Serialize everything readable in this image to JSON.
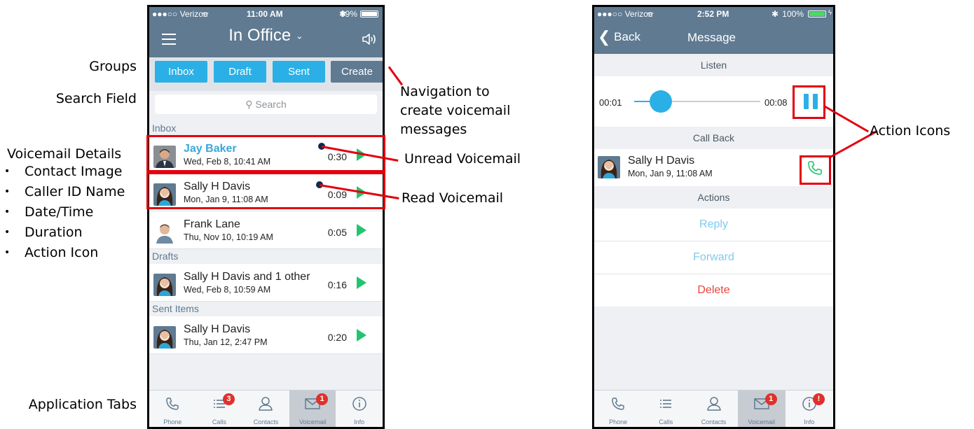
{
  "annotations": {
    "groups": "Groups",
    "search_field": "Search Field",
    "voicemail_details": "Voicemail Details",
    "details_list": [
      "Contact Image",
      "Caller ID Name",
      "Date/Time",
      "Duration",
      "Action Icon"
    ],
    "navigation": [
      "Navigation to",
      "create voicemail",
      "messages"
    ],
    "unread": "Unread Voicemail",
    "read": "Read Voicemail",
    "action_icons": "Action Icons",
    "application_tabs": "Application Tabs",
    "bullet": "•"
  },
  "left_phone": {
    "status": {
      "carrier": "●●●○○ Verizon",
      "time": "11:00 AM",
      "battery": "99%"
    },
    "title": "In Office",
    "groups": {
      "inbox": "Inbox",
      "draft": "Draft",
      "sent": "Sent",
      "create": "Create"
    },
    "search_placeholder": "Search",
    "sections": {
      "inbox": "Inbox",
      "drafts": "Drafts",
      "sent_items": "Sent Items"
    },
    "rows": [
      {
        "name": "Jay Baker",
        "date": "Wed, Feb 8, 10:41 AM",
        "duration": "0:30",
        "unread": true
      },
      {
        "name": "Sally H Davis",
        "date": "Mon, Jan 9, 11:08 AM",
        "duration": "0:09",
        "unread": false
      },
      {
        "name": "Frank Lane",
        "date": "Thu, Nov 10, 10:19 AM",
        "duration": "0:05",
        "unread": false
      },
      {
        "name": "Sally H Davis and 1 other",
        "date": "Wed, Feb 8, 10:59 AM",
        "duration": "0:16",
        "unread": false
      },
      {
        "name": "Sally H Davis",
        "date": "Thu, Jan 12, 2:47 PM",
        "duration": "0:20",
        "unread": false
      }
    ],
    "tabs": [
      {
        "label": "Phone",
        "icon": "phone-icon",
        "badge": ""
      },
      {
        "label": "Calls",
        "icon": "list-icon",
        "badge": "3"
      },
      {
        "label": "Contacts",
        "icon": "person-icon",
        "badge": ""
      },
      {
        "label": "Voicemail",
        "icon": "envelope-icon",
        "badge": "1"
      },
      {
        "label": "Info",
        "icon": "info-icon",
        "badge": ""
      }
    ]
  },
  "right_phone": {
    "status": {
      "carrier": "●●●○○ Verizon",
      "time": "2:52 PM",
      "battery": "100%"
    },
    "back": "Back",
    "title": "Message",
    "listen": "Listen",
    "time_start": "00:01",
    "time_end": "00:08",
    "playback_progress": 0.12,
    "call_back": "Call Back",
    "contact_name": "Sally H Davis",
    "contact_date": "Mon, Jan 9, 11:08 AM",
    "actions": "Actions",
    "reply": "Reply",
    "forward": "Forward",
    "delete": "Delete",
    "tabs": [
      {
        "label": "Phone",
        "icon": "phone-icon",
        "badge": ""
      },
      {
        "label": "Calls",
        "icon": "list-icon",
        "badge": ""
      },
      {
        "label": "Contacts",
        "icon": "person-icon",
        "badge": ""
      },
      {
        "label": "Voicemail",
        "icon": "envelope-icon",
        "badge": "1"
      },
      {
        "label": "Info",
        "icon": "info-icon",
        "badge": "!"
      }
    ]
  },
  "colors": {
    "nav": "#5f7a91",
    "accent": "#3aa6dc",
    "play": "#21c56f",
    "delete": "#e8453c",
    "highlight": "#e3000f"
  }
}
